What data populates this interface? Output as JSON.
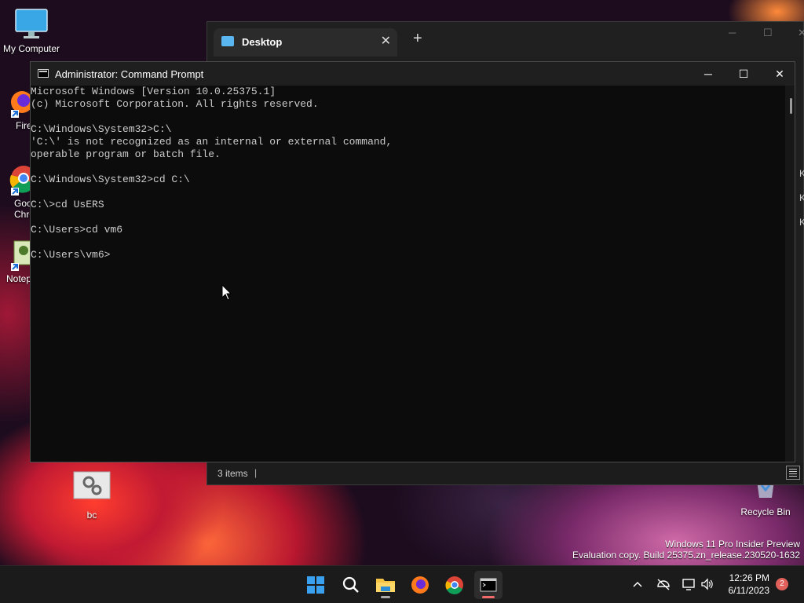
{
  "desktop": {
    "icons": [
      {
        "label": "My Computer"
      },
      {
        "label": "Fire"
      },
      {
        "label": "Goo Chro"
      },
      {
        "label": "Notep"
      },
      {
        "label": "bc"
      },
      {
        "label": "Recycle Bin"
      }
    ]
  },
  "explorer": {
    "tab_title": "Desktop",
    "close_glyph": "✕",
    "new_tab_glyph": "+",
    "status_items": "3 items",
    "status_sep": "|",
    "side_letters": [
      "K",
      "K",
      "K"
    ]
  },
  "cmd": {
    "title": "Administrator: Command Prompt",
    "min_glyph": "─",
    "max_glyph": "☐",
    "close_glyph": "✕",
    "lines": [
      "Microsoft Windows [Version 10.0.25375.1]",
      "(c) Microsoft Corporation. All rights reserved.",
      "",
      "C:\\Windows\\System32>C:\\",
      "'C:\\' is not recognized as an internal or external command,",
      "operable program or batch file.",
      "",
      "C:\\Windows\\System32>cd C:\\",
      "",
      "C:\\>cd UsERS",
      "",
      "C:\\Users>cd vm6",
      "",
      "C:\\Users\\vm6>"
    ]
  },
  "watermark": {
    "line1": "Windows 11 Pro Insider Preview",
    "line2": "Evaluation copy. Build 25375.zn_release.230520-1632"
  },
  "taskbar": {
    "apps": [
      "start-icon",
      "search-icon",
      "file-explorer-icon",
      "firefox-icon",
      "chrome-icon",
      "terminal-icon"
    ],
    "time": "12:26 PM",
    "date": "6/11/2023",
    "notification_count": "2"
  },
  "colors": {
    "console_bg": "#0c0c0c",
    "console_text": "#cccccc",
    "taskbar_bg": "#1b1b1b",
    "badge": "#e0605c"
  }
}
